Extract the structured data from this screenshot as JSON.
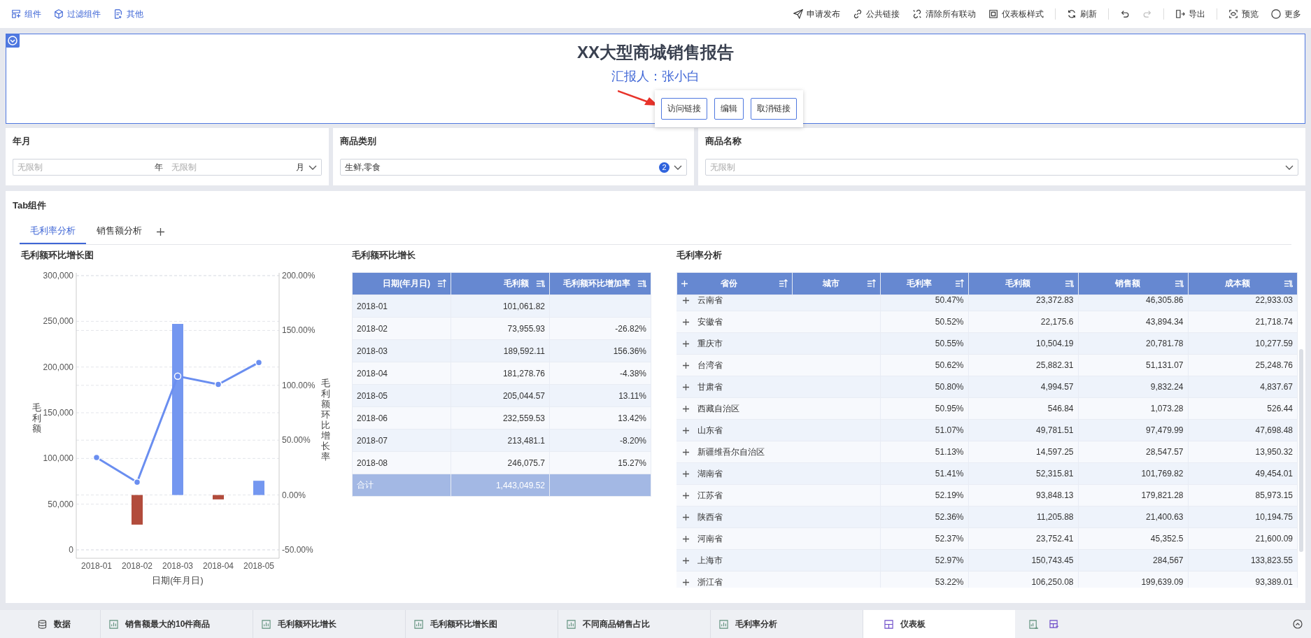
{
  "toolbar": {
    "left": [
      {
        "label": "组件"
      },
      {
        "label": "过滤组件"
      },
      {
        "label": "其他"
      }
    ],
    "right_groups": [
      [
        {
          "label": "申请发布"
        },
        {
          "label": "公共链接"
        },
        {
          "label": "清除所有联动"
        },
        {
          "label": "仪表板样式"
        }
      ],
      [
        {
          "label": "刷新"
        }
      ],
      [
        {
          "disabled": false
        },
        {
          "disabled": true
        }
      ],
      [
        {
          "label": "导出"
        }
      ],
      [
        {
          "label": "预览"
        },
        {
          "label": "更多"
        }
      ]
    ]
  },
  "report_header": {
    "title": "XX大型商城销售报告",
    "subtitle": "汇报人：张小白",
    "link_menu": {
      "buttons": [
        "访问链接",
        "编辑",
        "取消链接"
      ]
    }
  },
  "filters": [
    {
      "label": "年月",
      "kind": "year_month",
      "fields": [
        {
          "placeholder": "无限制",
          "unit": "年"
        },
        {
          "placeholder": "无限制",
          "unit": "月"
        }
      ]
    },
    {
      "label": "商品类别",
      "kind": "multi_select",
      "value": "生鲜,零食",
      "count": "2"
    },
    {
      "label": "商品名称",
      "kind": "select",
      "placeholder": "无限制"
    }
  ],
  "tab_component": {
    "title": "Tab组件",
    "tabs": [
      {
        "label": "毛利率分析",
        "selected": true
      },
      {
        "label": "销售额分析",
        "selected": false
      }
    ]
  },
  "widgets": {
    "chart": {
      "title": "毛利额环比增长图",
      "chart_data": {
        "type": "bar",
        "xlabel": "日期(年月日)",
        "ylabel": "毛利额",
        "categories": [
          "2018-01",
          "2018-02",
          "2018-03",
          "2018-04",
          "2018-05"
        ],
        "ylim": [
          0,
          300000
        ],
        "yticks": [
          {
            "value": 0,
            "label": "0"
          },
          {
            "value": 50000,
            "label": "50,000"
          },
          {
            "value": 100000,
            "label": "100,000"
          },
          {
            "value": 150000,
            "label": "150,000"
          },
          {
            "value": 200000,
            "label": "200,000"
          },
          {
            "value": 250000,
            "label": "250,000"
          },
          {
            "value": 300000,
            "label": "300,000"
          }
        ],
        "grid": true,
        "stacked": true,
        "y2label": "毛利额环比增长率",
        "y2lim": [
          -50,
          200
        ],
        "y2ticks": [
          {
            "value": -50,
            "label": "-50.00%"
          },
          {
            "value": 0,
            "label": "0.00%"
          },
          {
            "value": 50,
            "label": "50.00%"
          },
          {
            "value": 100,
            "label": "100.00%"
          },
          {
            "value": 150,
            "label": "150.00%"
          },
          {
            "value": 200,
            "label": "200.00%"
          }
        ],
        "series": [
          {
            "type": "bar",
            "axis": "y2",
            "color": "#7497f0",
            "values": [
              null,
              null,
              156,
              null,
              13
            ]
          },
          {
            "type": "bar",
            "axis": "y2",
            "color": "#b24c3c",
            "values": [
              null,
              -27,
              null,
              -4,
              null
            ]
          },
          {
            "type": "line",
            "marker": "circle",
            "color": "#6a8ef0",
            "values": [
              101000,
              74000,
              190000,
              181000,
              205000
            ]
          }
        ]
      }
    },
    "growth_table": {
      "title": "毛利额环比增长",
      "columns": [
        {
          "label": "日期(年月日)",
          "sorted": true
        },
        {
          "label": "毛利额",
          "sorted": false
        },
        {
          "label": "毛利额环比增加率",
          "sorted": false
        }
      ],
      "rows": [
        {
          "date": "2018-01",
          "profit": "101,061.82"
        },
        {
          "date": "2018-02",
          "profit": "73,955.93",
          "rate": "-26.82%"
        },
        {
          "date": "2018-03",
          "profit": "189,592.11",
          "rate": "156.36%"
        },
        {
          "date": "2018-04",
          "profit": "181,278.76",
          "rate": "-4.38%"
        },
        {
          "date": "2018-05",
          "profit": "205,044.57",
          "rate": "13.11%"
        },
        {
          "date": "2018-06",
          "profit": "232,559.53",
          "rate": "13.42%"
        },
        {
          "date": "2018-07",
          "profit": "213,481.1",
          "rate": "-8.20%"
        },
        {
          "date": "2018-08",
          "profit": "246,075.7",
          "rate": "15.27%"
        }
      ],
      "total": {
        "label": "合计",
        "profit": "1,443,049.52"
      }
    },
    "rate_table": {
      "title": "毛利率分析",
      "columns": [
        {
          "label": "省份",
          "sorted": true
        },
        {
          "label": "城市",
          "sorted": true
        },
        {
          "label": "毛利率",
          "sorted": true
        },
        {
          "label": "毛利额",
          "sorted": false
        },
        {
          "label": "销售额",
          "sorted": false
        },
        {
          "label": "成本额",
          "sorted": false
        }
      ],
      "rows": [
        {
          "province": "云南省",
          "values": [
            "50.47%",
            "23,372.83",
            "46,305.86",
            "22,933.03"
          ]
        },
        {
          "province": "安徽省",
          "values": [
            "50.52%",
            "22,175.6",
            "43,894.34",
            "21,718.74"
          ]
        },
        {
          "province": "重庆市",
          "values": [
            "50.55%",
            "10,504.19",
            "20,781.78",
            "10,277.59"
          ]
        },
        {
          "province": "台湾省",
          "values": [
            "50.62%",
            "25,882.31",
            "51,131.07",
            "25,248.76"
          ]
        },
        {
          "province": "甘肃省",
          "values": [
            "50.80%",
            "4,994.57",
            "9,832.24",
            "4,837.67"
          ]
        },
        {
          "province": "西藏自治区",
          "values": [
            "50.95%",
            "546.84",
            "1,073.28",
            "526.44"
          ]
        },
        {
          "province": "山东省",
          "values": [
            "51.07%",
            "49,781.51",
            "97,479.99",
            "47,698.48"
          ]
        },
        {
          "province": "新疆维吾尔自治区",
          "values": [
            "51.13%",
            "14,597.25",
            "28,547.57",
            "13,950.32"
          ]
        },
        {
          "province": "湖南省",
          "values": [
            "51.41%",
            "52,315.81",
            "101,769.82",
            "49,454.01"
          ]
        },
        {
          "province": "江苏省",
          "values": [
            "52.19%",
            "93,848.13",
            "179,821.28",
            "85,973.15"
          ]
        },
        {
          "province": "陕西省",
          "values": [
            "52.36%",
            "11,205.88",
            "21,400.63",
            "10,194.75"
          ]
        },
        {
          "province": "河南省",
          "values": [
            "52.37%",
            "23,752.41",
            "45,352.5",
            "21,600.09"
          ]
        },
        {
          "province": "上海市",
          "values": [
            "52.97%",
            "150,743.45",
            "284,567",
            "133,823.55"
          ]
        },
        {
          "province": "浙江省",
          "values": [
            "53.22%",
            "106,250.08",
            "199,639.09",
            "93,389.01"
          ]
        }
      ]
    }
  },
  "bottom_bar": {
    "data_label": "数据",
    "sheets": [
      {
        "label": "销售额最大的10件商品",
        "kind": "chart",
        "selected": false
      },
      {
        "label": "毛利额环比增长",
        "kind": "chart",
        "selected": false
      },
      {
        "label": "毛利额环比增长图",
        "kind": "chart",
        "selected": false
      },
      {
        "label": "不同商品销售占比",
        "kind": "chart",
        "selected": false
      },
      {
        "label": "毛利率分析",
        "kind": "chart",
        "selected": false
      },
      {
        "label": "仪表板",
        "kind": "dashboard",
        "selected": true
      }
    ]
  }
}
